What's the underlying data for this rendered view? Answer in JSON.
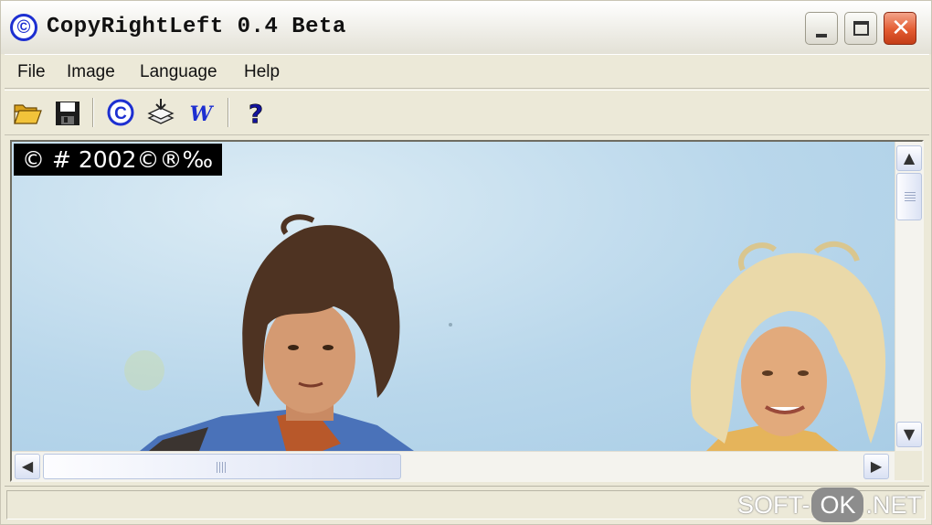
{
  "window": {
    "title": "CopyRightLeft 0.4 Beta",
    "app_icon_glyph": "©"
  },
  "title_buttons": {
    "minimize": "minimize-icon",
    "maximize": "maximize-icon",
    "close": "close-icon",
    "close_glyph": "✕"
  },
  "menu": {
    "items": [
      {
        "label": "File"
      },
      {
        "label": "Image"
      },
      {
        "label": "Language"
      },
      {
        "label": "Help"
      }
    ]
  },
  "toolbar": {
    "tools": [
      {
        "icon": "open-folder-icon"
      },
      {
        "icon": "save-disk-icon"
      },
      {
        "icon": "copyright-icon",
        "glyph": "©"
      },
      {
        "icon": "import-layers-icon"
      },
      {
        "icon": "watermark-w-icon",
        "glyph": "W"
      },
      {
        "icon": "help-question-icon",
        "glyph": "?"
      }
    ]
  },
  "image": {
    "watermark_text": "© # 2002©®‰",
    "description_hidden": ""
  },
  "scroll": {
    "up_glyph": "▲",
    "down_glyph": "▼",
    "left_glyph": "◀",
    "right_glyph": "▶"
  },
  "status": {
    "text": "",
    "site_prefix": "SOFT-",
    "site_pill": "OK",
    "site_suffix": ".NET"
  },
  "colors": {
    "accent_blue": "#1d2fd1",
    "close_red": "#e35b31",
    "folder_yellow": "#f2c33a"
  }
}
